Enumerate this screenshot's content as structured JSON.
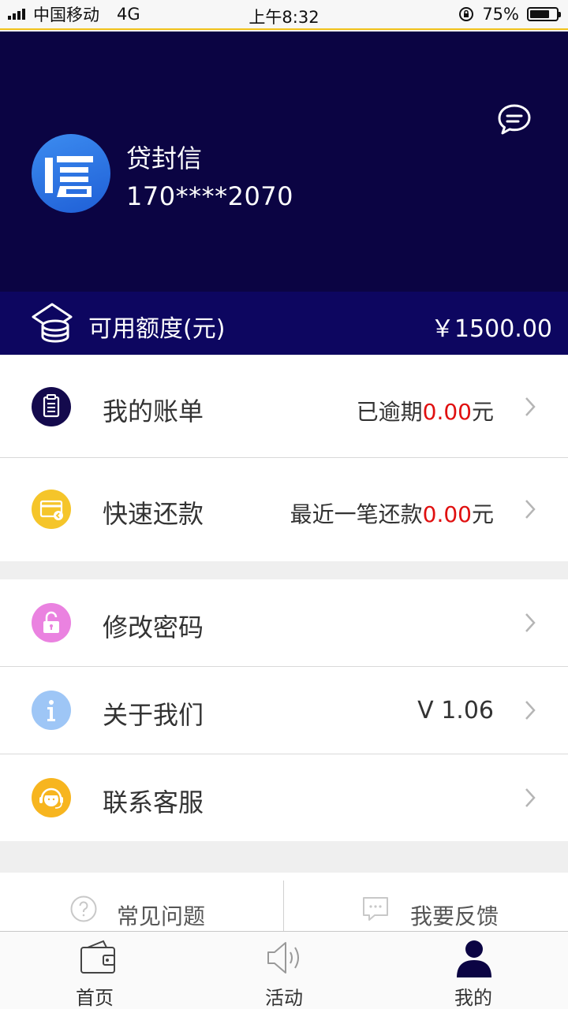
{
  "status_bar": {
    "carrier": "中国移动",
    "network": "4G",
    "time": "上午8:32",
    "battery": "75%",
    "battery_level": 0.75
  },
  "profile": {
    "name": "贷封信",
    "phone": "170****2070",
    "avatar_icon": "xin-logo-icon"
  },
  "credit": {
    "label": "可用额度(元)",
    "value": "￥1500.00"
  },
  "menu": {
    "bill": {
      "label": "我的账单",
      "prefix": "已逾期",
      "amount": "0.00",
      "suffix": "元",
      "icon": "bill-icon",
      "color": "#140a4d"
    },
    "repay": {
      "label": "快速还款",
      "prefix": "最近一笔还款",
      "amount": "0.00",
      "suffix": "元",
      "icon": "card-icon",
      "color": "#f5c52a"
    },
    "password": {
      "label": "修改密码",
      "icon": "lock-icon",
      "color": "#ea82e0"
    },
    "about": {
      "label": "关于我们",
      "value": "V 1.06",
      "icon": "info-icon",
      "color": "#9ec6f6"
    },
    "service": {
      "label": "联系客服",
      "icon": "customer-service-icon",
      "color": "#f7b51f"
    }
  },
  "links": {
    "faq": "常见问题",
    "feedback": "我要反馈"
  },
  "tabbar": {
    "home": "首页",
    "activity": "活动",
    "mine": "我的",
    "active": "mine"
  },
  "colors": {
    "header_bg": "#0b0443",
    "amount_red": "#e01010"
  }
}
